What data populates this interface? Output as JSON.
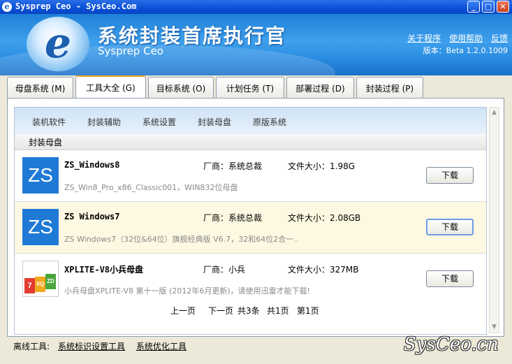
{
  "window": {
    "title": "Sysprep Ceo - SysCeo.Com",
    "app_icon": "e",
    "min_label": "_",
    "max_label": "□",
    "close_label": "✕"
  },
  "header": {
    "logo": "e",
    "cn_title": "系统封装首席执行官",
    "en_title": "Sysprep Ceo",
    "links": [
      "关于程序",
      "使用帮助",
      "反馈"
    ],
    "version": "版本：Beta 1.2.0.1009"
  },
  "tabs": [
    {
      "label": "母盘系统 (M)",
      "active": false
    },
    {
      "label": "工具大全 (G)",
      "active": true
    },
    {
      "label": "目标系统 (O)",
      "active": false
    },
    {
      "label": "计划任务 (T)",
      "active": false
    },
    {
      "label": "部署过程 (D)",
      "active": false
    },
    {
      "label": "封装过程 (P)",
      "active": false
    }
  ],
  "subnav": [
    "装机软件",
    "封装辅助",
    "系统设置",
    "封装母盘",
    "原版系统"
  ],
  "section_title": "封装母盘",
  "items": [
    {
      "thumb": "ZS",
      "name": "ZS_Windows8",
      "vendor": "厂商：系统总裁",
      "size": "文件大小：1.98G",
      "desc": "ZS_Win8_Pro_x86_Classic001，WIN832位母盘",
      "button": "下载"
    },
    {
      "thumb": "ZS",
      "name": "ZS Windows7",
      "vendor": "厂商：系统总裁",
      "size": "文件大小：2.08GB",
      "desc": "ZS Windows7（32位&64位）旗舰经典版 V6.7，32和64位2合一..",
      "button": "下载"
    },
    {
      "thumb": [
        "7",
        "XQ",
        "ZD"
      ],
      "name": "XPLITE-V8小兵母盘",
      "vendor": "厂商：小兵",
      "size": "文件大小：327MB",
      "desc": "小兵母盘XPLITE-V8 第十一版 (2012年6月更新)，请使用迅雷才能下载!",
      "button": "下载"
    }
  ],
  "pager": {
    "prev": "上一页",
    "next": "下一页",
    "total": "共3条",
    "pages": "共1页",
    "current": "第1页"
  },
  "footer": {
    "label": "离线工具:",
    "tools": [
      "系统标识设置工具",
      "系统优化工具"
    ]
  },
  "watermark": "SysCeo.cn",
  "colors": {
    "titlebar": "#0a4fd6",
    "banner": "#2b8ee3",
    "tab_accent": "#f5a623",
    "highlight_row": "#fdf8e1",
    "thumb_blue": "#1f7ad6"
  }
}
